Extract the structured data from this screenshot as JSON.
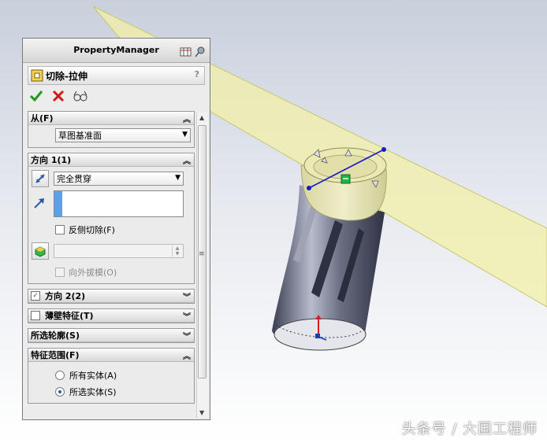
{
  "panel": {
    "title": "PropertyManager",
    "feature_name": "切除-拉伸",
    "help": "?"
  },
  "groups": {
    "from": {
      "label": "从(F)",
      "dropdown_value": "草图基准面"
    },
    "direction1": {
      "label": "方向 1(1)",
      "end_condition": "完全贯穿",
      "flip_side_label": "反侧切除(F)",
      "draft_outward_label": "向外拔模(O)"
    },
    "direction2": {
      "label": "方向 2(2)"
    },
    "thin_feature": {
      "label": "薄壁特征(T)"
    },
    "selected_contours": {
      "label": "所选轮廓(S)"
    },
    "feature_scope": {
      "label": "特征范围(F)",
      "options": [
        "所有实体(A)",
        "所选实体(S)"
      ]
    }
  },
  "watermark": "头条号 / 大国工程师",
  "colors": {
    "accent": "#2b5ba8",
    "plane": "#f1f0a8",
    "model": "#5f6378"
  },
  "icons": [
    "grid-icon",
    "pin-icon",
    "cut-extrude-icon",
    "ok-check-icon",
    "cancel-x-icon",
    "preview-glasses-icon",
    "flip-direction-icon",
    "direction-arrow-icon",
    "draft-cube-icon"
  ]
}
